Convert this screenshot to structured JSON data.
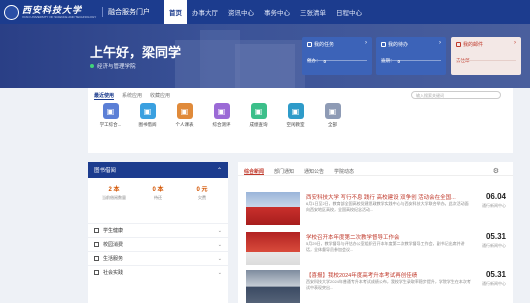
{
  "header": {
    "logo_text": "西安科技大学",
    "logo_subtitle": "XI'AN UNIVERSITY OF SCIENCE AND TECHNOLOGY",
    "portal_title": "融合服务门户",
    "nav": [
      "首页",
      "办事大厅",
      "资讯中心",
      "事务中心",
      "三张清单",
      "日程中心"
    ]
  },
  "banner": {
    "greeting": "上午好，梁同学",
    "department": "经济与管理学院",
    "cards": [
      {
        "title": "我的任务",
        "sub_label": "催办：",
        "sub_value": "0"
      },
      {
        "title": "我的待办",
        "sub_label": "逾期：",
        "sub_value": "0"
      },
      {
        "title": "我的邮件",
        "sub_label": "去往邮",
        "sub_value": ""
      }
    ]
  },
  "apps": {
    "tabs": [
      "最近使用",
      "系统应用",
      "收藏应用"
    ],
    "search_placeholder": "输入搜索关键词",
    "items": [
      {
        "label": "学工综合...",
        "color": "#5b7fd6",
        "icon": "user-icon"
      },
      {
        "label": "图书借阅",
        "color": "#3aa0e0",
        "icon": "book-icon"
      },
      {
        "label": "个人课表",
        "color": "#e08a3a",
        "icon": "calendar-icon"
      },
      {
        "label": "综合测评",
        "color": "#9b6ad6",
        "icon": "chart-icon"
      },
      {
        "label": "成绩查询",
        "color": "#3cbf8a",
        "icon": "score-icon"
      },
      {
        "label": "空闲教室",
        "color": "#2e9bc9",
        "icon": "room-icon"
      },
      {
        "label": "全部",
        "color": "#8e9bb5",
        "icon": "grid-icon"
      }
    ]
  },
  "library": {
    "title": "图书借阅",
    "stats": [
      {
        "value": "2 本",
        "label": "当前借阅数量"
      },
      {
        "value": "0 本",
        "label": "待还"
      },
      {
        "value": "0 元",
        "label": "欠费"
      }
    ],
    "rows": [
      "学生健康",
      "校园消费",
      "生活服务",
      "社会实践"
    ]
  },
  "news": {
    "tabs": [
      "综合新闻",
      "部门通知",
      "通知公告",
      "学院动态"
    ],
    "items": [
      {
        "title": "西安科技大学 写行不息 践行 高校建设 双争创 活动会在全国...",
        "desc": "6月1日至2日，教育部全国高校党建思政教学实践中心与西安科技大学联合举办。此次活动面向西安地区高校，全国高校纪念活动...",
        "date": "06.04",
        "source": "通行新闻中心"
      },
      {
        "title": "学校召开本年度第二次教学督导工作会",
        "desc": "5月29日，教学督导与评估办公室组织召开本年度第二次教学督导工作会，副书记出席并讲话，全体督导员参加会议...",
        "date": "05.31",
        "source": "通行新闻中心"
      },
      {
        "title": "【喜报】我校2024年度高考升本考试再创佳绩",
        "desc": "西安科技大学2024年普通专升本考试成绩公布，我校学生录取率稳步提升，学院学生在本次考试中表现突出...",
        "date": "05.31",
        "source": "通行新闻中心"
      }
    ]
  }
}
